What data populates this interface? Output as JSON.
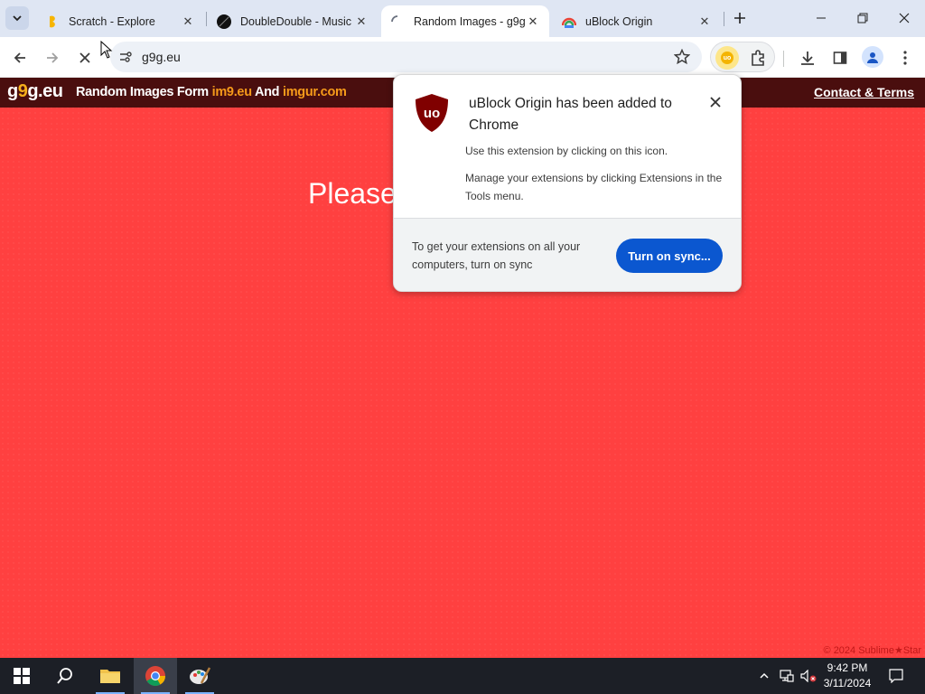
{
  "browser": {
    "tabs": [
      {
        "title": "Scratch - Explore",
        "favicon": "scratch-icon",
        "active": false
      },
      {
        "title": "DoubleDouble - Music",
        "favicon": "doubledouble-icon",
        "active": false
      },
      {
        "title": "Random Images - g9g",
        "favicon": "loading-spinner-icon",
        "active": true
      },
      {
        "title": "uBlock Origin",
        "favicon": "chrome-web-store-icon",
        "active": false
      }
    ],
    "url": "g9g.eu"
  },
  "site": {
    "logo_pre": "g",
    "logo_nine": "9",
    "logo_post": "g.eu",
    "tagline_1": "Random Images Form ",
    "tagline_link1": "im9.eu",
    "tagline_2": " And ",
    "tagline_link2": "imgur.com",
    "contact": "Contact & Terms",
    "please_text": "Please",
    "copyright": "© 2024 Sublime★Star"
  },
  "bubble": {
    "title": "uBlock Origin has been added to Chrome",
    "desc1": "Use this extension by clicking on this icon.",
    "desc2": "Manage your extensions by clicking Extensions in the Tools menu.",
    "sync_text": "To get your extensions on all your computers, turn on sync",
    "sync_button": "Turn on sync..."
  },
  "taskbar": {
    "time": "9:42 PM",
    "date": "3/11/2024"
  },
  "colors": {
    "page_bg": "#ff4040",
    "header_bg": "#4a0e0e",
    "accent_blue": "#0b57d0",
    "ublock_red": "#800000"
  }
}
